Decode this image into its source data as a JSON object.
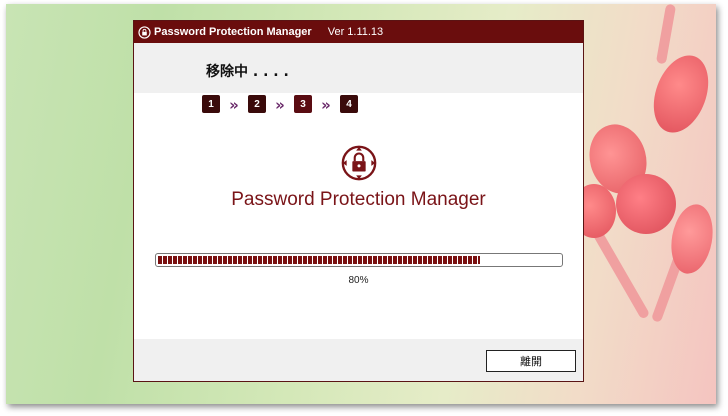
{
  "window": {
    "title": "Password Protection Manager",
    "version": "Ver 1.11.13"
  },
  "status": {
    "text": "移除中 . . . ."
  },
  "steps": [
    {
      "label": "1",
      "separator": "»"
    },
    {
      "label": "2",
      "separator": "»"
    },
    {
      "label": "3",
      "separator": "»"
    },
    {
      "label": "4"
    }
  ],
  "current_step": 3,
  "product": {
    "name": "Password Protection Manager",
    "logo_icon": "lock-target-icon"
  },
  "progress": {
    "value": 0.8,
    "label": "80%"
  },
  "footer": {
    "close_label": "離開"
  },
  "colors": {
    "brand": "#6a0d0d",
    "accent_text": "#7a1418",
    "progress": "#7a1010"
  }
}
